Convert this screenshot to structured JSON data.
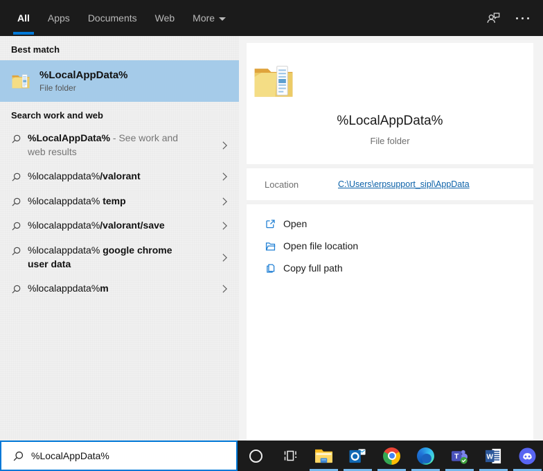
{
  "colors": {
    "accent": "#0078d7",
    "best_match_highlight": "#a5cbe9",
    "link": "#0b61a8",
    "running_indicator": "#76b9ed",
    "topbar_bg": "#1b1b1b"
  },
  "topbar": {
    "tabs": [
      {
        "label": "All",
        "active": true,
        "dropdown": false
      },
      {
        "label": "Apps",
        "active": false,
        "dropdown": false
      },
      {
        "label": "Documents",
        "active": false,
        "dropdown": false
      },
      {
        "label": "Web",
        "active": false,
        "dropdown": false
      },
      {
        "label": "More",
        "active": false,
        "dropdown": true
      }
    ],
    "icons": [
      "feedback-icon",
      "more-options-icon"
    ]
  },
  "left_panel": {
    "best_match_header": "Best match",
    "best_match": {
      "icon": "folder-icon",
      "title": "%LocalAppData%",
      "subtitle": "File folder"
    },
    "search_header": "Search work and web",
    "suggestions": [
      {
        "parts": [
          {
            "text": "%LocalAppData%",
            "style": "bold"
          },
          {
            "text": " - See work and web results",
            "style": "muted"
          }
        ]
      },
      {
        "parts": [
          {
            "text": "%localappdata%",
            "style": "normal"
          },
          {
            "text": "/valorant",
            "style": "bold"
          }
        ]
      },
      {
        "parts": [
          {
            "text": "%localappdata% ",
            "style": "normal"
          },
          {
            "text": "temp",
            "style": "bold"
          }
        ]
      },
      {
        "parts": [
          {
            "text": "%localappdata%",
            "style": "normal"
          },
          {
            "text": "/valorant/save",
            "style": "bold"
          }
        ]
      },
      {
        "parts": [
          {
            "text": "%localappdata% ",
            "style": "normal"
          },
          {
            "text": "google chrome user data",
            "style": "bold"
          }
        ]
      },
      {
        "parts": [
          {
            "text": "%localappdata%",
            "style": "normal"
          },
          {
            "text": "m",
            "style": "bold"
          }
        ]
      }
    ]
  },
  "preview": {
    "icon": "folder-icon",
    "title": "%LocalAppData%",
    "subtitle": "File folder",
    "location_label": "Location",
    "location_link": "C:\\Users\\erpsupport_sipl\\AppData",
    "actions": [
      {
        "icon": "open-icon",
        "label": "Open"
      },
      {
        "icon": "open-file-location-icon",
        "label": "Open file location"
      },
      {
        "icon": "copy-icon",
        "label": "Copy full path"
      }
    ]
  },
  "search_bar": {
    "value": "%LocalAppData%",
    "icon": "search-icon"
  },
  "taskbar": {
    "items": [
      {
        "name": "cortana",
        "running": false
      },
      {
        "name": "task-view",
        "running": false
      },
      {
        "name": "file-explorer",
        "running": true
      },
      {
        "name": "outlook",
        "running": true
      },
      {
        "name": "chrome",
        "running": true
      },
      {
        "name": "edge",
        "running": true
      },
      {
        "name": "teams",
        "running": true
      },
      {
        "name": "word",
        "running": true
      },
      {
        "name": "discord",
        "running": true
      }
    ]
  }
}
